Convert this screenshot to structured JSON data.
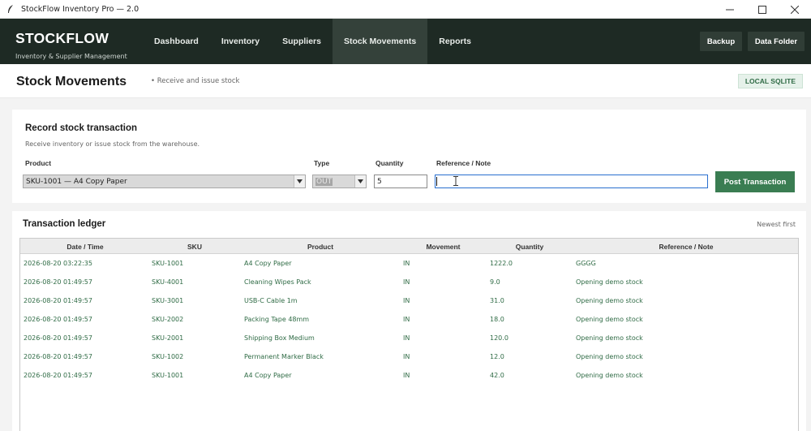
{
  "window": {
    "title": "StockFlow Inventory Pro — 2.0"
  },
  "brand": {
    "name": "STOCKFLOW",
    "tagline": "Inventory & Supplier Management"
  },
  "nav": [
    "Dashboard",
    "Inventory",
    "Suppliers",
    "Stock Movements",
    "Reports"
  ],
  "nav_active": "Stock Movements",
  "header_buttons": {
    "backup": "Backup",
    "data_folder": "Data Folder"
  },
  "page": {
    "title": "Stock Movements",
    "subtitle": "• Receive and issue stock",
    "badge": "LOCAL SQLITE"
  },
  "record": {
    "title": "Record stock transaction",
    "subtitle": "Receive inventory or issue stock from the warehouse.",
    "labels": {
      "product": "Product",
      "type": "Type",
      "quantity": "Quantity",
      "reference": "Reference / Note"
    },
    "product_value": "SKU-1001 — A4 Copy Paper",
    "type_value": "OUT",
    "quantity_value": "5",
    "reference_value": "",
    "post_label": "Post Transaction"
  },
  "ledger": {
    "title": "Transaction ledger",
    "sort_note": "Newest first",
    "columns": [
      "Date / Time",
      "SKU",
      "Product",
      "Movement",
      "Quantity",
      "Reference / Note"
    ],
    "rows": [
      [
        "2026-08-20 03:22:35",
        "SKU-1001",
        "A4 Copy Paper",
        "IN",
        "1222.0",
        "GGGG"
      ],
      [
        "2026-08-20 01:49:57",
        "SKU-4001",
        "Cleaning Wipes Pack",
        "IN",
        "9.0",
        "Opening demo stock"
      ],
      [
        "2026-08-20 01:49:57",
        "SKU-3001",
        "USB-C Cable 1m",
        "IN",
        "31.0",
        "Opening demo stock"
      ],
      [
        "2026-08-20 01:49:57",
        "SKU-2002",
        "Packing Tape 48mm",
        "IN",
        "18.0",
        "Opening demo stock"
      ],
      [
        "2026-08-20 01:49:57",
        "SKU-2001",
        "Shipping Box Medium",
        "IN",
        "120.0",
        "Opening demo stock"
      ],
      [
        "2026-08-20 01:49:57",
        "SKU-1002",
        "Permanent Marker Black",
        "IN",
        "12.0",
        "Opening demo stock"
      ],
      [
        "2026-08-20 01:49:57",
        "SKU-1001",
        "A4 Copy Paper",
        "IN",
        "42.0",
        "Opening demo stock"
      ]
    ]
  },
  "colors": {
    "header_bg": "#1e2a24",
    "accent": "#3a7d52",
    "row_text": "#2f6b45"
  }
}
